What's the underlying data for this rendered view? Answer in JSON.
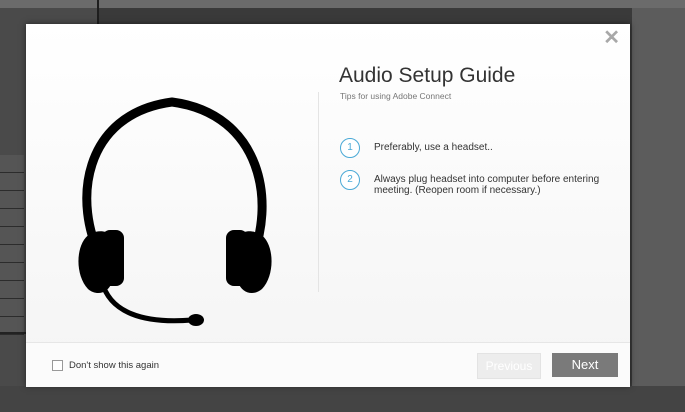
{
  "dialog": {
    "title": "Audio Setup Guide",
    "subtitle": "Tips for using Adobe Connect",
    "close_glyph": "✕",
    "steps": [
      {
        "number": "1",
        "text": "Preferably, use a headset.."
      },
      {
        "number": "2",
        "text": "Always plug headset into computer before entering meeting. (Reopen room if necessary.)"
      }
    ],
    "dont_show_label": "Don't show this again",
    "previous_label": "Previous",
    "next_label": "Next"
  },
  "icons": {
    "illustration": "headset-icon",
    "close": "close-icon"
  },
  "colors": {
    "accent": "#4aa9d6",
    "next_button": "#7a7a7a",
    "previous_button_disabled": "#ededed"
  }
}
